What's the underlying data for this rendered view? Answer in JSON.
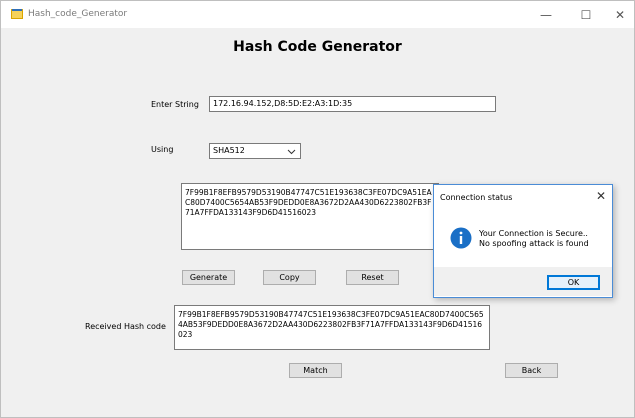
{
  "window": {
    "title": "Hash_code_Generator",
    "controls": {
      "minimize": "—",
      "maximize": "☐",
      "close": "✕"
    }
  },
  "heading": "Hash Code Generator",
  "form": {
    "enter_string_label": "Enter String",
    "enter_string_value": "172.16.94.152,D8:5D:E2:A3:1D:35",
    "using_label": "Using",
    "algorithm_selected": "SHA512",
    "generated_hash": "7F99B1F8EFB9579D53190B47747C51E193638C3FE07DC9A51EAC80D7400C5654AB53F9DEDD0E8A3672D2AA430D6223802FB3F71A7FFDA133143F9D6D41516023",
    "received_label": "Received Hash code",
    "received_hash": "7F99B1F8EFB9579D53190B47747C51E193638C3FE07DC9A51EAC80D7400C5654AB53F9DEDD0E8A3672D2AA430D6223802FB3F71A7FFDA133143F9D6D41516023"
  },
  "buttons": {
    "generate": "Generate",
    "copy": "Copy",
    "reset": "Reset",
    "match": "Match",
    "back": "Back"
  },
  "dialog": {
    "title": "Connection status",
    "close": "✕",
    "line1": "Your Connection is Secure..",
    "line2": " No spoofing attack is found",
    "icon": "info-icon",
    "ok": "OK"
  },
  "colors": {
    "dialog_border": "#4a8cd6",
    "info_icon": "#1a6fc6",
    "ok_border": "#0078d7"
  }
}
